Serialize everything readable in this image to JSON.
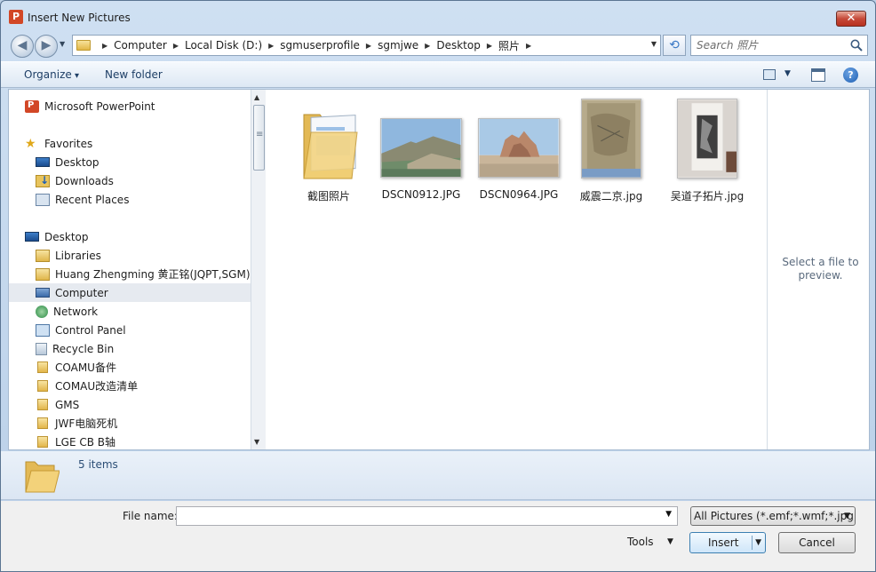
{
  "window": {
    "title": "Insert New Pictures",
    "app_icon_letter": "P",
    "close_glyph": "✕"
  },
  "nav": {
    "back_glyph": "◀",
    "forward_glyph": "▶",
    "breadcrumbs": [
      "Computer",
      "Local Disk (D:)",
      "sgmuserprofile",
      "sgmjwe",
      "Desktop",
      "照片"
    ],
    "refresh_glyph": "⟲",
    "search_placeholder": "Search 照片"
  },
  "toolbar": {
    "organize_label": "Organize",
    "new_folder_label": "New folder",
    "help_glyph": "?"
  },
  "sidebar": {
    "items": [
      {
        "label": "Microsoft PowerPoint",
        "icon": "powerpoint-icon"
      },
      {
        "label": "Favorites",
        "icon": "star-icon"
      },
      {
        "label": "Desktop",
        "icon": "desktop-icon"
      },
      {
        "label": "Downloads",
        "icon": "downloads-icon"
      },
      {
        "label": "Recent Places",
        "icon": "recent-places-icon"
      },
      {
        "label": "Desktop",
        "icon": "desktop-icon"
      },
      {
        "label": "Libraries",
        "icon": "libraries-icon"
      },
      {
        "label": "Huang Zhengming 黄正铭(JQPT,SGM)",
        "icon": "user-folder-icon"
      },
      {
        "label": "Computer",
        "icon": "computer-icon",
        "selected": true
      },
      {
        "label": "Network",
        "icon": "network-icon"
      },
      {
        "label": "Control Panel",
        "icon": "control-panel-icon"
      },
      {
        "label": "Recycle Bin",
        "icon": "recycle-bin-icon"
      },
      {
        "label": "COAMU备件",
        "icon": "folder-icon"
      },
      {
        "label": "COMAU改造清单",
        "icon": "folder-icon"
      },
      {
        "label": "GMS",
        "icon": "folder-icon"
      },
      {
        "label": "JWF电脑死机",
        "icon": "folder-icon"
      },
      {
        "label": "LGE CB B轴",
        "icon": "folder-icon"
      }
    ]
  },
  "files": [
    {
      "name": "截图照片",
      "kind": "folder"
    },
    {
      "name": "DSCN0912.JPG",
      "kind": "photo-landscape"
    },
    {
      "name": "DSCN0964.JPG",
      "kind": "photo-landscape"
    },
    {
      "name": "威震二京.jpg",
      "kind": "photo-portrait"
    },
    {
      "name": "吴道子拓片.jpg",
      "kind": "photo-portrait"
    }
  ],
  "preview": {
    "message": "Select a file to preview."
  },
  "details": {
    "item_count": "5 items"
  },
  "bottom": {
    "file_name_label": "File name:",
    "file_name_value": "",
    "filter_value": "All Pictures (*.emf;*.wmf;*.jpg;*",
    "tools_label": "Tools",
    "insert_label": "Insert",
    "cancel_label": "Cancel"
  }
}
